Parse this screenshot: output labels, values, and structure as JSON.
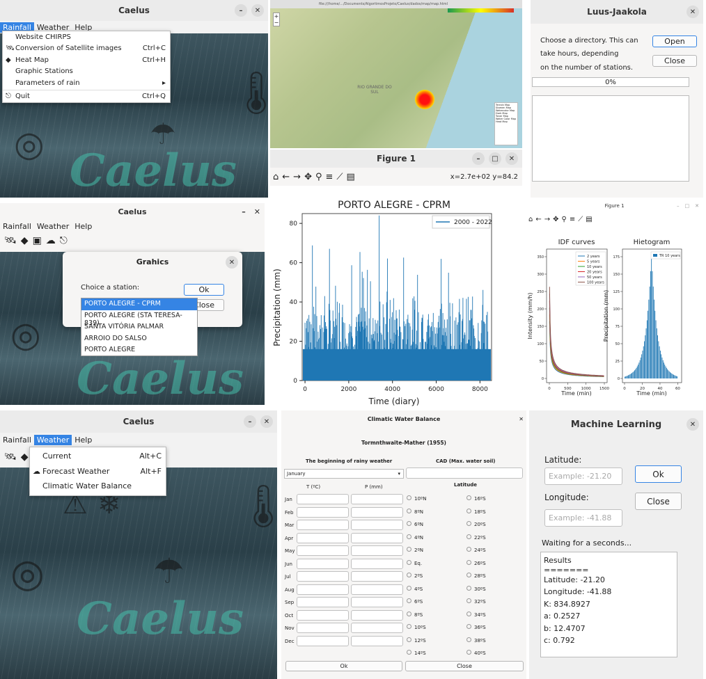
{
  "p1": {
    "title": "Caelus",
    "menu": [
      "Rainfall",
      "Weather",
      "Help"
    ],
    "items": [
      {
        "label": "Website CHIRPS",
        "shortcut": "",
        "icon": ""
      },
      {
        "label": "Conversion of Satellite images",
        "shortcut": "Ctrl+C",
        "icon": "satellite-icon"
      },
      {
        "label": "Heat Map",
        "shortcut": "Ctrl+H",
        "icon": "brazil-map-icon"
      },
      {
        "label": "Graphic Stations",
        "shortcut": "",
        "icon": ""
      },
      {
        "label": "Parameters of rain",
        "shortcut": "",
        "icon": ""
      },
      {
        "label": "Quit",
        "shortcut": "Ctrl+Q",
        "icon": "exit-icon"
      }
    ],
    "bg_word": "Caelus"
  },
  "p2": {
    "url": "file:///home/.../Documents/AlgoritmosProjeto/Caelus/dados/map/map.html",
    "map_labels": [
      "RIO GRANDE DO SUL"
    ],
    "layers": [
      "Terrain Map",
      "Stamen Map",
      "Watercolor Map",
      "Dark Map",
      "Toner Map",
      "Water Color Map",
      "Heat Map"
    ]
  },
  "p3": {
    "title": "Luus-Jaakola",
    "msg1": "Choose a directory. This can",
    "msg2": "take hours, depending",
    "msg3": "on the number of stations.",
    "open": "Open",
    "close": "Close",
    "progress": "0%",
    "progress_value": 0
  },
  "p4": {
    "title": "Caelus",
    "menu": [
      "Rainfall",
      "Weather",
      "Help"
    ],
    "dialog_title": "Grahics",
    "choice": "Choice a station:",
    "ok": "Ok",
    "close": "Close",
    "stations": [
      "PORTO ALEGRE - CPRM",
      "PORTO ALEGRE (STA TERESA-839)",
      "SANTA VITÓRIA PALMAR",
      "ARROIO DO SALSO",
      "PORTO ALEGRE"
    ],
    "bg_word": "Caelus"
  },
  "p5": {
    "title": "Figure 1",
    "coords": "x=2.7e+02 y=84.2"
  },
  "p7": {
    "title": "Figure 1"
  },
  "p8": {
    "title": "Caelus",
    "menu": [
      "Rainfall",
      "Weather",
      "Help"
    ],
    "items": [
      {
        "label": "Current",
        "shortcut": "Alt+C",
        "icon": ""
      },
      {
        "label": "Forecast Weather",
        "shortcut": "Alt+F",
        "icon": "cloud-icon"
      },
      {
        "label": "Climatic Water Balance",
        "shortcut": "",
        "icon": ""
      }
    ],
    "bg_word": "Caelus"
  },
  "p9": {
    "title": "Climatic Water Balance",
    "subtitle": "Tormnthwaite-Mather (1955)",
    "col1": "The beginning of rainy weather",
    "col2": "CAD (Max. water soil)",
    "select": "January",
    "th_t": "T (ºC)",
    "th_p": "P (mm)",
    "lat": "Latitude",
    "months": [
      "Jan",
      "Feb",
      "Mar",
      "Apr",
      "May",
      "Jun",
      "Jul",
      "Aug",
      "Sep",
      "Oct",
      "Nov",
      "Dec"
    ],
    "latA": [
      "10ºN",
      "8ºN",
      "6ºN",
      "4ºN",
      "2ºN",
      "Eq.",
      "2ºS",
      "4ºS",
      "6ºS",
      "8ºS",
      "10ºS",
      "12ºS",
      "14ºS"
    ],
    "latB": [
      "16ºS",
      "18ºS",
      "20ºS",
      "22ºS",
      "24ºS",
      "26ºS",
      "28ºS",
      "30ºS",
      "32ºS",
      "34ºS",
      "36ºS",
      "38ºS",
      "40ºS"
    ],
    "ok": "Ok",
    "close": "Close"
  },
  "p10": {
    "title": "Machine Learning",
    "lat_label": "Latitude:",
    "lat_ph": "Example: -21.20",
    "lon_label": "Longitude:",
    "lon_ph": "Example: -41.88",
    "ok": "Ok",
    "close": "Close",
    "waiting": "Waiting for a seconds...",
    "results": [
      "Results",
      "=======",
      "Latitude: -21.20",
      "Longitude: -41.88",
      "K: 834.8927",
      "a: 0.2527",
      "b: 12.4707",
      "c: 0.792"
    ]
  },
  "chart_data": [
    {
      "type": "bar",
      "title": "PORTO ALEGRE - CPRM",
      "xlabel": "Time (diary)",
      "ylabel": "Precipitation (mm)",
      "xlim": [
        0,
        8400
      ],
      "ylim": [
        0,
        85
      ],
      "xticks": [
        0,
        2000,
        4000,
        6000,
        8000
      ],
      "yticks": [
        0,
        20,
        40,
        60,
        80
      ],
      "legend": "2000 - 2022",
      "legend_loc": "top-right",
      "color": "#1f77b4",
      "max_value": 84,
      "typical_range": [
        0,
        40
      ]
    },
    {
      "type": "line",
      "title": "IDF curves",
      "xlabel": "Time (min)",
      "ylabel": "Intensity (mm/h)",
      "xticks": [
        0,
        500,
        1000,
        1500
      ],
      "yticks": [
        0,
        50,
        100,
        150,
        200,
        250,
        300,
        350
      ],
      "ylim": [
        0,
        370
      ],
      "legend_loc": "top-right",
      "series": [
        {
          "name": "2 years",
          "color": "#1f77b4"
        },
        {
          "name": "5 years",
          "color": "#ff7f0e"
        },
        {
          "name": "10 years",
          "color": "#2ca02c"
        },
        {
          "name": "20 years",
          "color": "#d62728"
        },
        {
          "name": "50 years",
          "color": "#9467bd"
        },
        {
          "name": "100 years",
          "color": "#8c564b"
        }
      ]
    },
    {
      "type": "bar",
      "title": "Hietogram",
      "xlabel": "Time (min)",
      "ylabel": "Precipitation (mm)",
      "xticks": [
        0,
        20,
        40,
        60
      ],
      "yticks": [
        0,
        25,
        50,
        75,
        100,
        125,
        150,
        175
      ],
      "ylim": [
        0,
        180
      ],
      "legend": "TR 10 years",
      "legend_loc": "top-right",
      "peak": 172
    }
  ]
}
